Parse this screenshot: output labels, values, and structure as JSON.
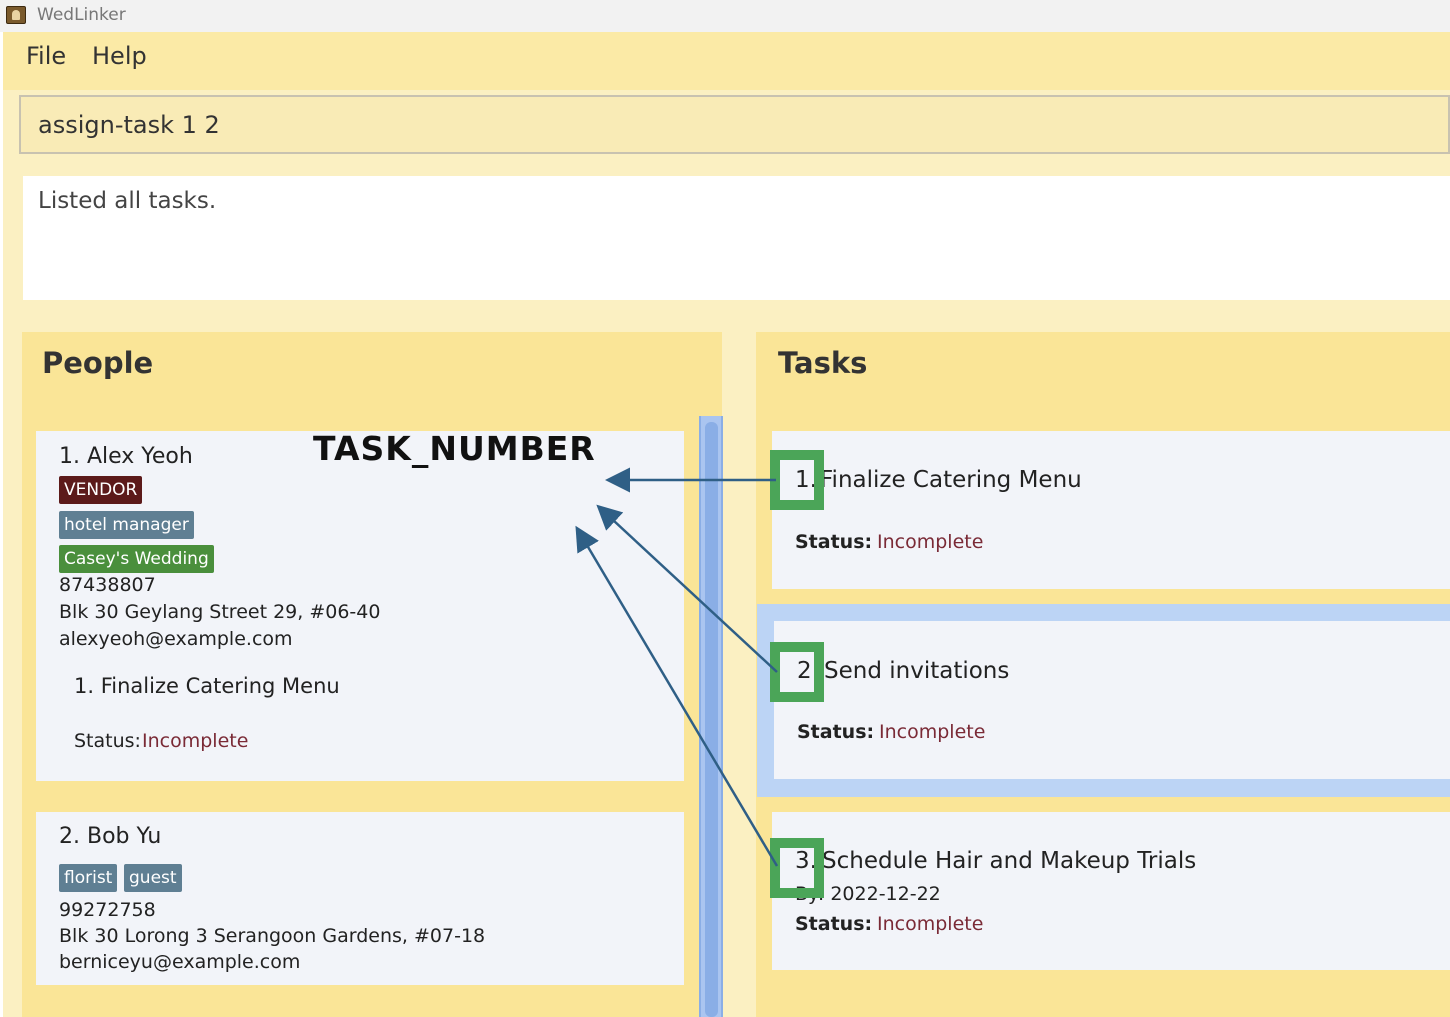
{
  "window": {
    "title": "WedLinker"
  },
  "menu": {
    "file": "File",
    "help": "Help"
  },
  "command": {
    "value": "assign-task 1 2"
  },
  "result": {
    "message": "Listed all tasks."
  },
  "people_panel": {
    "title": "People",
    "persons": [
      {
        "heading": "1. Alex Yeoh",
        "tags": {
          "vendor": "VENDOR",
          "role": "hotel manager",
          "wedding": "Casey's Wedding"
        },
        "phone": "87438807",
        "address": "Blk 30 Geylang Street 29, #06-40",
        "email": "alexyeoh@example.com",
        "task": {
          "name": "1.  Finalize Catering Menu",
          "status_label": "Status:",
          "status_value": "Incomplete"
        }
      },
      {
        "heading": "2. Bob Yu",
        "tags": {
          "role1": "florist",
          "role2": "guest"
        },
        "phone": "99272758",
        "address": "Blk 30 Lorong 3 Serangoon Gardens, #07-18",
        "email": "berniceyu@example.com"
      }
    ]
  },
  "tasks_panel": {
    "title": "Tasks",
    "tasks": [
      {
        "number": "1.",
        "name": "Finalize Catering Menu",
        "status_label": "Status:",
        "status_value": "Incomplete",
        "selected": false
      },
      {
        "number": "2.",
        "name": "Send invitations",
        "status_label": "Status:",
        "status_value": "Incomplete",
        "selected": true
      },
      {
        "number": "3.",
        "name": "Schedule Hair and Makeup Trials",
        "by": "By: 2022-12-22",
        "status_label": "Status:",
        "status_value": "Incomplete",
        "selected": false
      }
    ]
  },
  "annotation": {
    "label": "TASK_NUMBER",
    "highlight_color": "#4ba558",
    "arrow_color": "#2f5f86"
  },
  "colors": {
    "menu_bg": "#fbeaa6",
    "panel_bg": "#fae597",
    "card_bg": "#f2f4f9",
    "status_incomplete": "#7a2a36",
    "selection": "#bcd4f5"
  }
}
